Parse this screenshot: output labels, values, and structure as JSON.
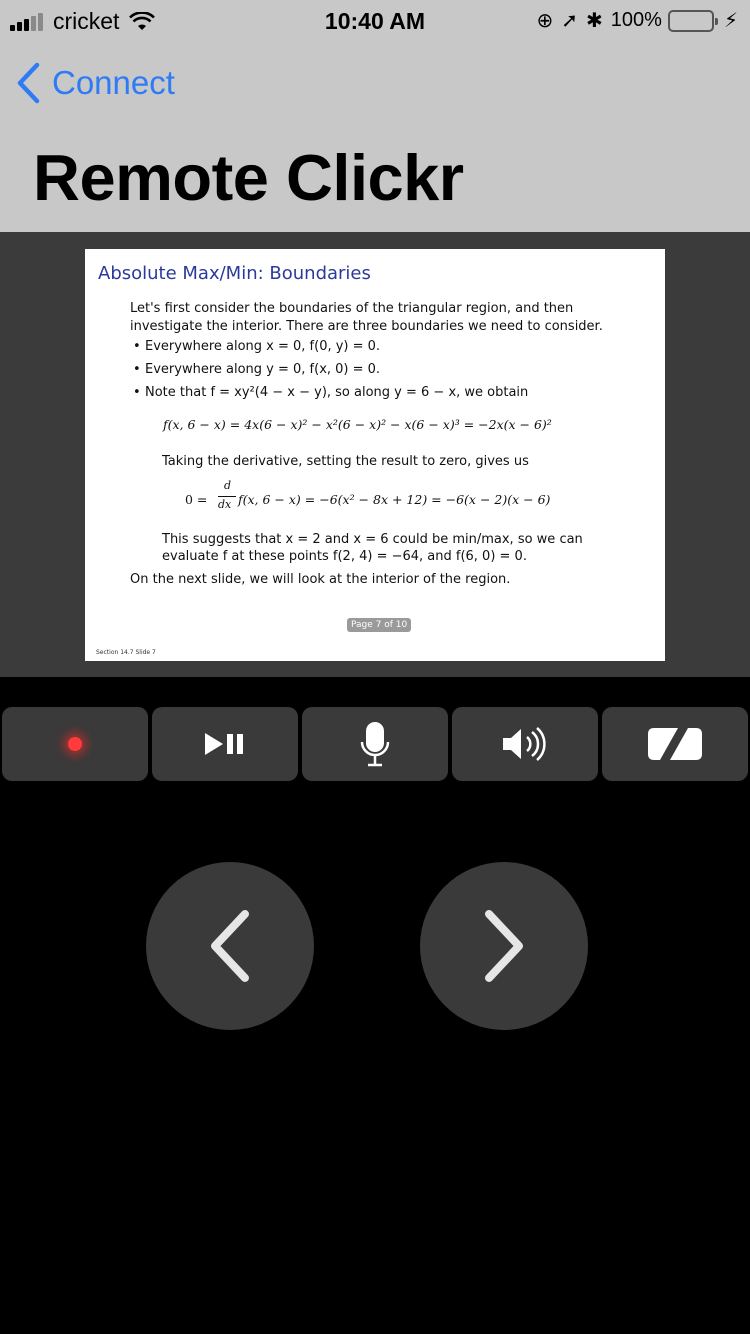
{
  "status_bar": {
    "carrier": "cricket",
    "time": "10:40 AM",
    "battery_percent": "100%",
    "battery_color": "#f5c842"
  },
  "nav": {
    "back_label": "Connect",
    "title": "Remote Clickr",
    "accent": "#2f7bf6"
  },
  "slide": {
    "title": "Absolute Max/Min:  Boundaries",
    "intro_line1": "Let's first consider the boundaries of the triangular region, and then",
    "intro_line2": "investigate the interior.  There are three boundaries we need to consider.",
    "bullet1": "Everywhere along x = 0,  f(0, y) = 0.",
    "bullet2": "Everywhere along y = 0,  f(x, 0) = 0.",
    "bullet3": "Note that f = xy²(4 − x − y), so along y = 6 − x, we obtain",
    "equation1": "f(x, 6 − x) = 4x(6 − x)² − x²(6 − x)² − x(6 − x)³ = −2x(x − 6)²",
    "derivative_text": "Taking the derivative, setting the result to zero, gives us",
    "equation2_lhs": "0 =",
    "equation2_num": "d",
    "equation2_den": "dx",
    "equation2_rhs": "f(x, 6 − x) = −6(x² − 8x + 12) = −6(x − 2)(x − 6)",
    "suggest_line1": "This suggests that x = 2 and x = 6 could be min/max, so we can",
    "suggest_line2": "evaluate f at these points f(2, 4) = −64, and f(6, 0) = 0.",
    "next_slide_text": "On the next slide, we will look at the interior of the region.",
    "page_label": "Page 7 of 10",
    "footer": "Section 14.7    Slide 7"
  },
  "controls": {
    "record_icon": "record-dot-icon",
    "play_pause_icon": "play-pause-icon",
    "mic_icon": "microphone-icon",
    "volume_icon": "speaker-icon",
    "blank_icon": "blank-screen-icon",
    "record_color": "#ff3b3b"
  },
  "navigation": {
    "prev_icon": "chevron-left-icon",
    "next_icon": "chevron-right-icon"
  }
}
